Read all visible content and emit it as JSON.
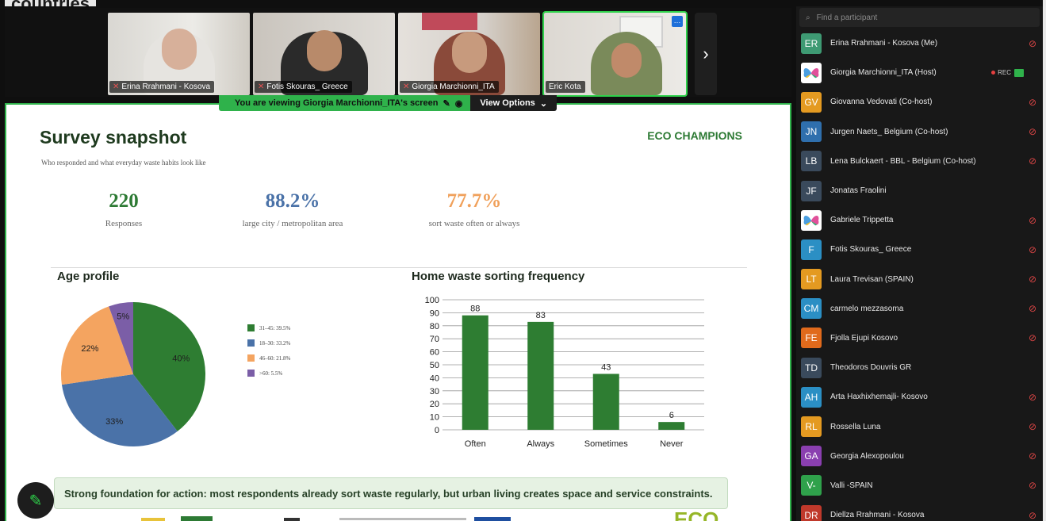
{
  "top_clipped_text": "countries",
  "video_tiles": [
    {
      "name": "Erina Rrahmani - Kosova",
      "muted": true
    },
    {
      "name": "Fotis Skouras_ Greece",
      "muted": true
    },
    {
      "name": "Giorgia Marchionni_ITA",
      "muted": true
    },
    {
      "name": "Eric Kota",
      "muted": false
    }
  ],
  "banner": {
    "viewing_text": "You are viewing Giorgia Marchionni_ITA's screen",
    "view_options": "View Options"
  },
  "slide": {
    "title": "Survey snapshot",
    "subtitle": "Who responded and what everyday waste habits look like",
    "brand": "ECO CHAMPIONS",
    "stats": [
      {
        "value": "220",
        "label": "Responses",
        "color": "#2d7a34"
      },
      {
        "value": "88.2%",
        "label": "large city / metropolitan area",
        "color": "#4a72a8"
      },
      {
        "value": "77.7%",
        "label": "sort waste often or always",
        "color": "#f0a05a"
      }
    ],
    "age_title": "Age profile",
    "freq_title": "Home waste sorting frequency",
    "takeaway": "Strong foundation for action: most respondents already sort waste regularly, but urban living creates space and service constraints.",
    "footer_logo": "ECO"
  },
  "chart_data": [
    {
      "type": "pie",
      "title": "Age profile",
      "categories": [
        "31-45",
        "18-30",
        "46-60",
        ">60"
      ],
      "values": [
        39.5,
        33.2,
        21.8,
        5.5
      ],
      "slice_labels": [
        "40%",
        "33%",
        "22%",
        "5%"
      ],
      "legend": [
        "31–45: 39.5%",
        "18–30: 33.2%",
        "46–60: 21.8%",
        ">60: 5.5%"
      ],
      "colors": [
        "#2e7d32",
        "#4a72a8",
        "#f4a460",
        "#7b5ea7"
      ],
      "legend_position": "right"
    },
    {
      "type": "bar",
      "title": "Home waste sorting frequency",
      "categories": [
        "Often",
        "Always",
        "Sometimes",
        "Never"
      ],
      "values": [
        88,
        83,
        43,
        6
      ],
      "ylim": [
        0,
        100
      ],
      "yticks": [
        0,
        10,
        20,
        30,
        40,
        50,
        60,
        70,
        80,
        90,
        100
      ],
      "color": "#2e7d32",
      "grid": true
    }
  ],
  "participants": {
    "search_placeholder": "Find a participant",
    "list": [
      {
        "initials": "ER",
        "name": "Erina Rrahmani - Kosova (Me)",
        "color": "#3e9a73",
        "muted": true
      },
      {
        "initials": "",
        "name": "Giorgia Marchionni_ITA (Host)",
        "color": "butterfly",
        "muted": false,
        "rec": "REC"
      },
      {
        "initials": "GV",
        "name": "Giovanna Vedovati (Co-host)",
        "color": "#e49a21",
        "muted": true
      },
      {
        "initials": "JN",
        "name": "Jurgen Naets_ Belgium (Co-host)",
        "color": "#2f6fad",
        "muted": true
      },
      {
        "initials": "LB",
        "name": "Lena Bulckaert - BBL - Belgium (Co-host)",
        "color": "#3a4a5c",
        "muted": true
      },
      {
        "initials": "JF",
        "name": "Jonatas Fraolini",
        "color": "#3a4a5c",
        "muted": false
      },
      {
        "initials": "",
        "name": "Gabriele Trippetta",
        "color": "butterfly",
        "muted": true
      },
      {
        "initials": "F",
        "name": "Fotis Skouras_ Greece",
        "color": "#2b8fc4",
        "muted": true
      },
      {
        "initials": "LT",
        "name": "Laura Trevisan (SPAIN)",
        "color": "#e49a21",
        "muted": true
      },
      {
        "initials": "CM",
        "name": "carmelo mezzasoma",
        "color": "#2b8fc4",
        "muted": true
      },
      {
        "initials": "FE",
        "name": "Fjolla Ejupi Kosovo",
        "color": "#e06a1c",
        "muted": true
      },
      {
        "initials": "TD",
        "name": "Theodoros Douvris GR",
        "color": "#3a4a5c",
        "muted": false
      },
      {
        "initials": "AH",
        "name": "Arta Haxhixhemajli- Kosovo",
        "color": "#2b8fc4",
        "muted": true
      },
      {
        "initials": "RL",
        "name": "Rossella Luna",
        "color": "#e49a21",
        "muted": true
      },
      {
        "initials": "GA",
        "name": "Georgia Alexopoulou",
        "color": "#8a3fb0",
        "muted": true
      },
      {
        "initials": "V-",
        "name": "Valli -SPAIN",
        "color": "#2fa14b",
        "muted": true
      },
      {
        "initials": "DR",
        "name": "Diellza Rrahmani - Kosova",
        "color": "#c0392b",
        "muted": true
      }
    ]
  }
}
